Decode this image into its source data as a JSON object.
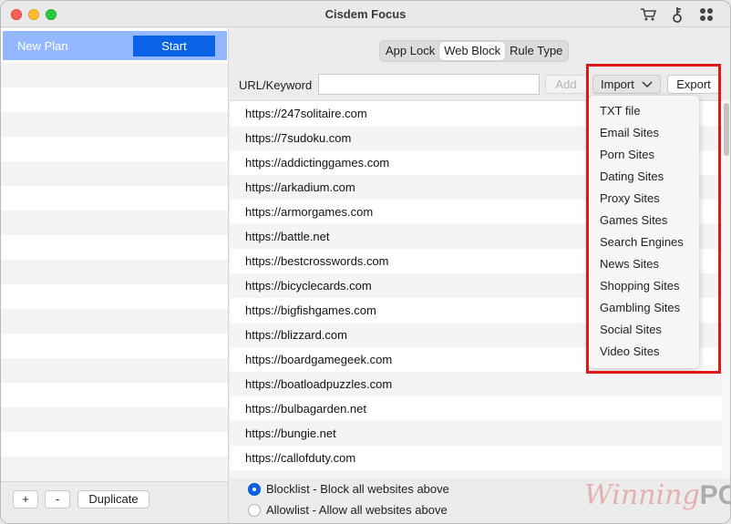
{
  "app": {
    "title": "Cisdem Focus"
  },
  "titlebar_icons": [
    "cart-icon",
    "key-icon",
    "apps-grid-icon"
  ],
  "sidebar": {
    "plan_name": "New Plan",
    "start_label": "Start",
    "add_label": "+",
    "remove_label": "-",
    "duplicate_label": "Duplicate"
  },
  "tabs": [
    {
      "label": "App Lock",
      "active": false
    },
    {
      "label": "Web Block",
      "active": true
    },
    {
      "label": "Rule Type",
      "active": false
    }
  ],
  "url_bar": {
    "label": "URL/Keyword",
    "value": "",
    "add_label": "Add",
    "import_label": "Import",
    "export_label": "Export"
  },
  "sites": [
    "https://247solitaire.com",
    "https://7sudoku.com",
    "https://addictinggames.com",
    "https://arkadium.com",
    "https://armorgames.com",
    "https://battle.net",
    "https://bestcrosswords.com",
    "https://bicyclecards.com",
    "https://bigfishgames.com",
    "https://blizzard.com",
    "https://boardgamegeek.com",
    "https://boatloadpuzzles.com",
    "https://bulbagarden.net",
    "https://bungie.net",
    "https://callofduty.com"
  ],
  "import_menu": [
    "TXT file",
    "Email Sites",
    "Porn Sites",
    "Dating Sites",
    "Proxy Sites",
    "Games Sites",
    "Search Engines",
    "News Sites",
    "Shopping Sites",
    "Gambling Sites",
    "Social Sites",
    "Video Sites"
  ],
  "mode": {
    "blocklist_label": "Blocklist - Block all websites above",
    "allowlist_label": "Allowlist - Allow all websites above",
    "selected": "blocklist"
  },
  "watermark": {
    "part1": "Winning",
    "part2": "PC"
  },
  "colors": {
    "accent": "#0a63e6",
    "selection": "#93b8ff",
    "highlight": "#e01818"
  }
}
